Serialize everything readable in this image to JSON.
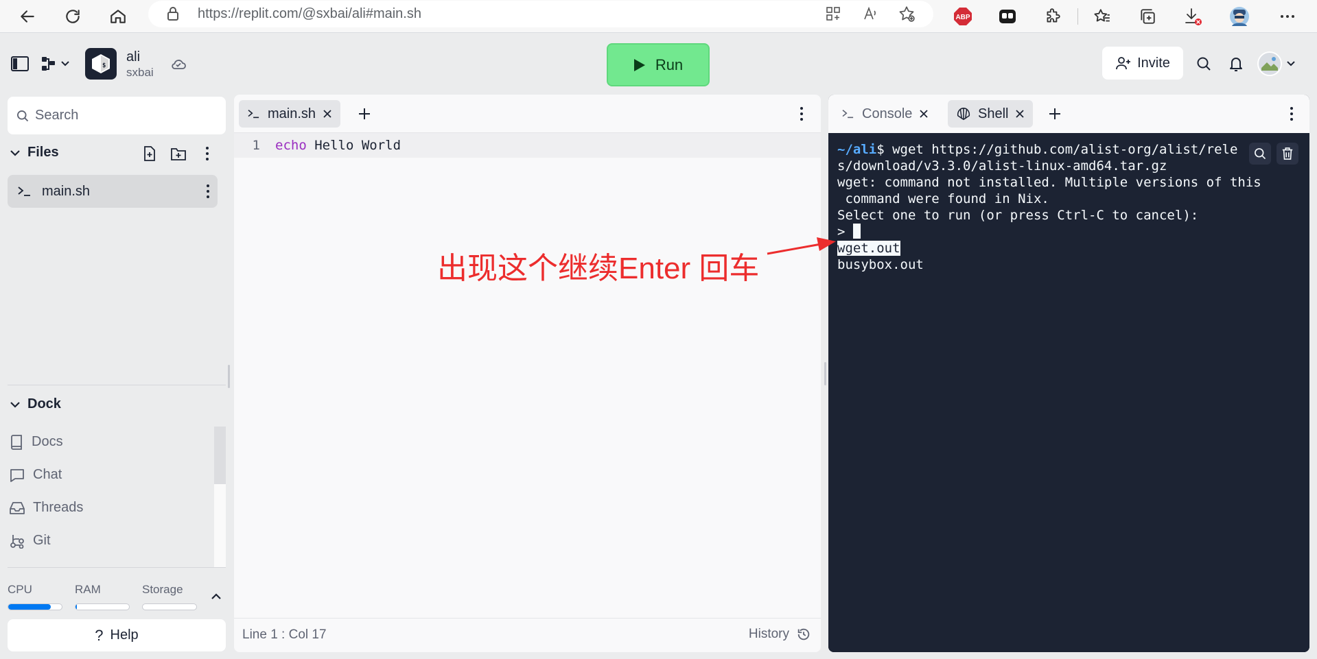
{
  "browser": {
    "url": "https://replit.com/@sxbai/ali#main.sh",
    "icons": [
      "back-icon",
      "refresh-icon",
      "home-icon",
      "lock-icon",
      "app-available-icon",
      "read-aloud-icon",
      "favorite-add-icon",
      "adblock-icon",
      "extension-icon",
      "puzzle-icon",
      "favorites-icon",
      "collections-icon",
      "downloads-icon",
      "profile-icon",
      "more-icon"
    ],
    "adblock_label": "ABP"
  },
  "header": {
    "repl_name": "ali",
    "owner": "sxbai",
    "run_label": "Run",
    "invite_label": "Invite",
    "run_color": "#72e88f"
  },
  "sidebar": {
    "search_placeholder": "Search",
    "files_title": "Files",
    "files": [
      {
        "name": "main.sh",
        "icon": "terminal-icon"
      }
    ],
    "dock_title": "Dock",
    "dock_items": [
      {
        "label": "Docs",
        "icon": "book-icon"
      },
      {
        "label": "Chat",
        "icon": "chat-icon"
      },
      {
        "label": "Threads",
        "icon": "inbox-icon"
      },
      {
        "label": "Git",
        "icon": "git-icon"
      }
    ],
    "resources": [
      {
        "label": "CPU",
        "usage": 0.8
      },
      {
        "label": "RAM",
        "usage": 0.03
      },
      {
        "label": "Storage",
        "usage": 0
      }
    ],
    "help_label": "Help"
  },
  "editor": {
    "tab_label": "main.sh",
    "line_number": "1",
    "code_keyword": "echo",
    "code_rest": " Hello World",
    "cursor_position": "Line 1 : Col 17",
    "history_label": "History"
  },
  "terminal": {
    "tabs": [
      {
        "label": "Console",
        "icon": "terminal-icon"
      },
      {
        "label": "Shell",
        "icon": "shell-icon",
        "active": true
      }
    ],
    "prompt_dir": "~/ali",
    "lines": {
      "cmd_part1": "$ wget https://github.com/alist-org/alist/rele",
      "cmd_part2": "s/download/v3.3.0/alist-linux-amd64.tar.gz",
      "err1": "wget: command not installed. Multiple versions of this",
      "err2": " command were found in Nix.",
      "select": "Select one to run (or press Ctrl-C to cancel):",
      "prompt": "> ",
      "option_selected": "wget.out",
      "option_other": "busybox.out"
    }
  },
  "annotation": {
    "text": "出现这个继续Enter 回车",
    "color": "#ec2d2d"
  }
}
